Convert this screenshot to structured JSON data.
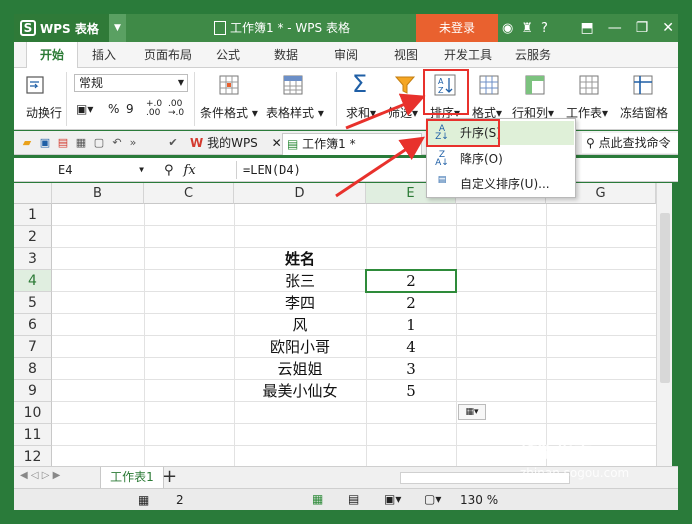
{
  "titlebar": {
    "app_name": "WPS 表格",
    "logo_letter": "S",
    "doc_title": "工作簿1 * - WPS 表格",
    "login_label": "未登录",
    "help_label": "?"
  },
  "menu": {
    "tabs": [
      "开始",
      "插入",
      "页面布局",
      "公式",
      "数据",
      "审阅",
      "视图",
      "开发工具",
      "云服务"
    ]
  },
  "ribbon": {
    "wrap_text": "动换行",
    "number_format": "常规",
    "percent_symbol": "%",
    "comma_symbol": "9",
    "cond_format": "条件格式",
    "table_style": "表格样式",
    "sum": "求和",
    "filter": "筛选",
    "sort": "排序",
    "format": "格式",
    "row_col": "行和列",
    "worksheet": "工作表",
    "freeze": "冻结窗格"
  },
  "quickbar": {
    "tab1": "我的WPS",
    "tab2": "工作簿1 *",
    "find": "点此查找命令"
  },
  "formula_bar": {
    "cell_ref": "E4",
    "fx_label": "fx",
    "formula": "=LEN(D4)"
  },
  "grid": {
    "columns": [
      "B",
      "C",
      "D",
      "E",
      "F",
      "G"
    ],
    "rows": [
      "1",
      "2",
      "3",
      "4",
      "5",
      "6",
      "7",
      "8",
      "9",
      "10",
      "11",
      "12"
    ],
    "header_label": "姓名",
    "data": [
      {
        "name": "张三",
        "len": "2"
      },
      {
        "name": "李四",
        "len": "2"
      },
      {
        "name": "风",
        "len": "1"
      },
      {
        "name": "欧阳小哥",
        "len": "4"
      },
      {
        "name": "云姐姐",
        "len": "3"
      },
      {
        "name": "最美小仙女",
        "len": "5"
      }
    ]
  },
  "sort_menu": {
    "ascending": "升序(S)",
    "descending": "降序(O)",
    "custom": "自定义排序(U)..."
  },
  "sheetbar": {
    "sheet_name": "工作表1",
    "add": "+"
  },
  "statusbar": {
    "count": "2",
    "zoom": "130 %"
  },
  "watermark": {
    "line1": "搜狗指南",
    "line2": "zhinan.sogou.com"
  },
  "colors": {
    "accent": "#2e8b3a",
    "highlight_red": "#e8312c",
    "login_orange": "#e9612f"
  }
}
